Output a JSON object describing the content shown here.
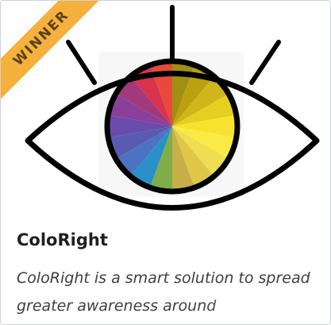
{
  "card": {
    "badge": "WINNER",
    "title": "ColoRight",
    "description": "ColoRight is a smart solution to spread greater awareness around"
  },
  "colors": {
    "badge_background": "#f5b13d",
    "badge_text": "#5a4116",
    "eye_outline": "#000000",
    "title_text": "#1d1f21",
    "description_text": "#3c3f42",
    "card_border": "#cfd3d6"
  },
  "icons": {
    "thumbnail": "eye-with-color-wheel-iris-icon"
  }
}
